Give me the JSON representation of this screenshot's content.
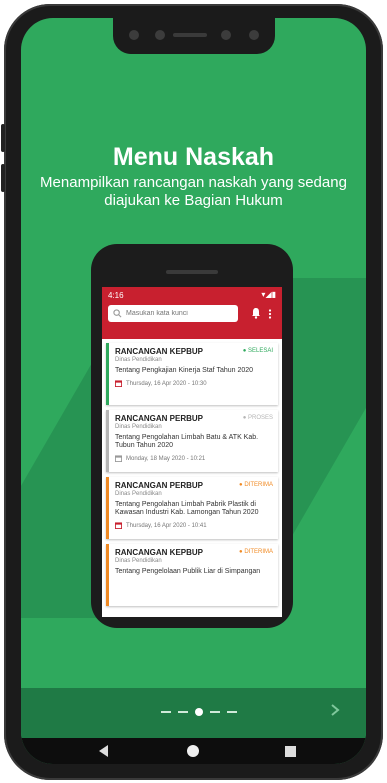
{
  "onboarding": {
    "heading": "Menu Naskah",
    "subtitle": "Menampilkan rancangan naskah yang sedang diajukan ke Bagian Hukum",
    "page_index": 3,
    "page_count": 5,
    "next_icon": "chevron-right-icon"
  },
  "app": {
    "status_time": "4:16",
    "status_icons": "▾◢▮",
    "search_placeholder": "Masukan kata kunci",
    "header_color": "#c8202f",
    "items": [
      {
        "title": "RANCANGAN KEPBUP",
        "dept": "Dinas Pendidikan",
        "desc": "Tentang Pengkajian Kinerja Staf Tahun 2020",
        "date": "Thursday, 16 Apr 2020 - 10:30",
        "status": "● SELESAI",
        "color": "#2fa95d"
      },
      {
        "title": "RANCANGAN PERBUP",
        "dept": "Dinas Pendidikan",
        "desc": "Tentang Pengolahan Limbah Batu & ATK Kab. Tubun Tahun 2020",
        "date": "Monday, 18 May 2020 - 10:21",
        "status": "● PROSES",
        "color": "#b5b5b5"
      },
      {
        "title": "RANCANGAN PERBUP",
        "dept": "Dinas Pendidikan",
        "desc": "Tentang Pengolahan Limbah Pabrik Plastik di Kawasan Industri Kab. Lamongan Tahun 2020",
        "date": "Thursday, 16 Apr 2020 - 10:41",
        "status": "● DITERIMA",
        "color": "#f08a24"
      },
      {
        "title": "RANCANGAN KEPBUP",
        "dept": "Dinas Pendidikan",
        "desc": "Tentang Pengelolaan Publik Liar di Simpangan",
        "date": "",
        "status": "● DITERIMA",
        "color": "#f08a24"
      }
    ]
  },
  "navbar": {
    "back": "back-icon",
    "home": "home-icon",
    "recent": "recent-apps-icon"
  }
}
